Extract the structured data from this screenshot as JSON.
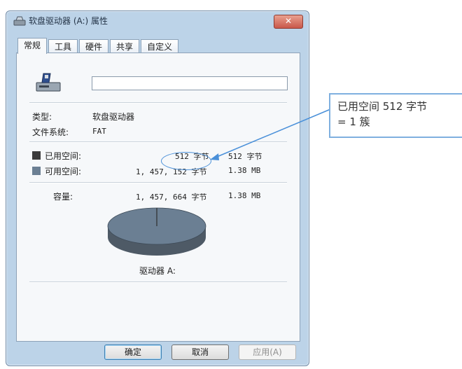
{
  "window": {
    "title": "软盘驱动器 (A:) 属性",
    "close_label": "✕"
  },
  "tabs": [
    {
      "label": "常规",
      "active": true
    },
    {
      "label": "工具",
      "active": false
    },
    {
      "label": "硬件",
      "active": false
    },
    {
      "label": "共享",
      "active": false
    },
    {
      "label": "自定义",
      "active": false
    }
  ],
  "general": {
    "name_value": "",
    "type_label": "类型:",
    "type_value": "软盘驱动器",
    "fs_label": "文件系统:",
    "fs_value": "FAT",
    "used": {
      "label": "已用空间:",
      "bytes": "512 字节",
      "size": "512 字节",
      "color": "#3b3b3b"
    },
    "free": {
      "label": "可用空间:",
      "bytes": "1, 457, 152 字节",
      "size": "1.38 MB",
      "color": "#6b7f93"
    },
    "capacity": {
      "label": "容量:",
      "bytes": "1, 457, 664 字节",
      "size": "1.38 MB"
    },
    "drive_label": "驱动器 A:"
  },
  "buttons": {
    "ok": "确定",
    "cancel": "取消",
    "apply": "应用(A)"
  },
  "annotation": {
    "text_line1": "已用空间 512 字节",
    "text_line2": "= 1 簇",
    "color": "#4a90d9"
  }
}
